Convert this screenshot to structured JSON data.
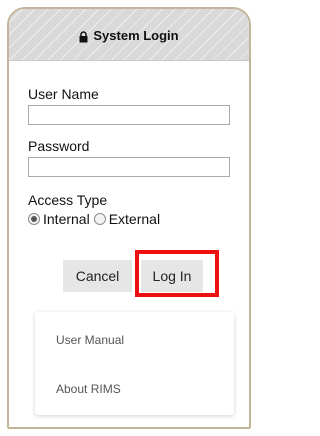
{
  "header": {
    "title": "System Login",
    "icon": "lock-icon"
  },
  "form": {
    "username_label": "User Name",
    "username_value": "",
    "password_label": "Password",
    "password_value": "",
    "access_type_label": "Access Type",
    "access_options": [
      {
        "label": "Internal",
        "checked": true
      },
      {
        "label": "External",
        "checked": false
      }
    ]
  },
  "buttons": {
    "cancel_label": "Cancel",
    "login_label": "Log In"
  },
  "highlight_color": "#ee0f0f",
  "links": [
    {
      "label": "User Manual"
    },
    {
      "label": "About RIMS"
    }
  ]
}
